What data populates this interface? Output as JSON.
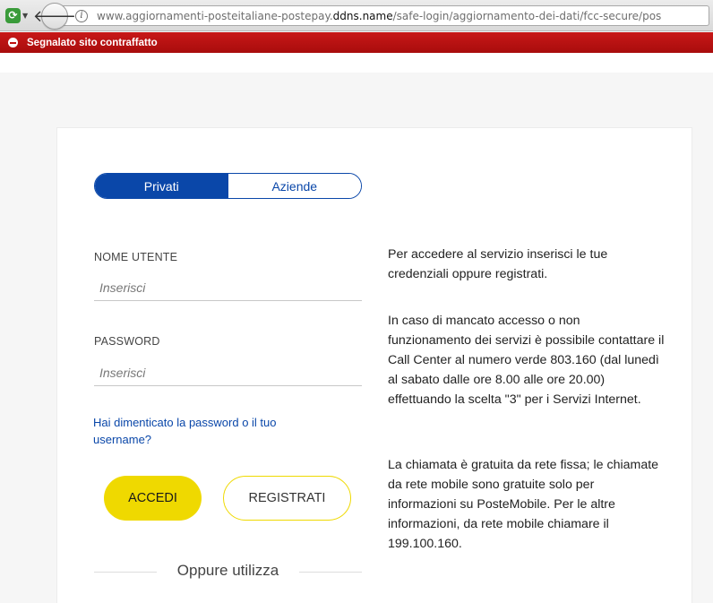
{
  "browser": {
    "url_prefix": "www.aggiornamenti-posteitaliane-postepay.",
    "url_domain": "ddns.name",
    "url_path": "/safe-login/aggiornamento-dei-dati/fcc-secure/pos",
    "warning": "Segnalato sito contraffatto"
  },
  "tabs": {
    "privati": "Privati",
    "aziende": "Aziende"
  },
  "form": {
    "username_label": "NOME UTENTE",
    "username_placeholder": "Inserisci",
    "password_label": "PASSWORD",
    "password_placeholder": "Inserisci",
    "forgot_link": "Hai dimenticato la password o il tuo username?",
    "login_button": "ACCEDI",
    "register_button": "REGISTRATI",
    "alt_login": "Oppure utilizza"
  },
  "info": {
    "p1": "Per accedere al servizio inserisci le tue credenziali oppure registrati.",
    "p2": "In caso di mancato accesso o non funzionamento dei servizi è possibile contattare il Call Center al numero verde 803.160 (dal lunedì al sabato dalle ore 8.00 alle ore 20.00) effettuando la scelta \"3\" per i Servizi Internet.",
    "p3": "La chiamata è gratuita da rete fissa; le chiamate da rete mobile sono gratuite solo per informazioni su PosteMobile. Per le altre informazioni, da rete mobile chiamare il 199.100.160."
  },
  "colors": {
    "brand_blue": "#0a47a9",
    "brand_yellow": "#efd900",
    "warning_red": "#c01010"
  }
}
